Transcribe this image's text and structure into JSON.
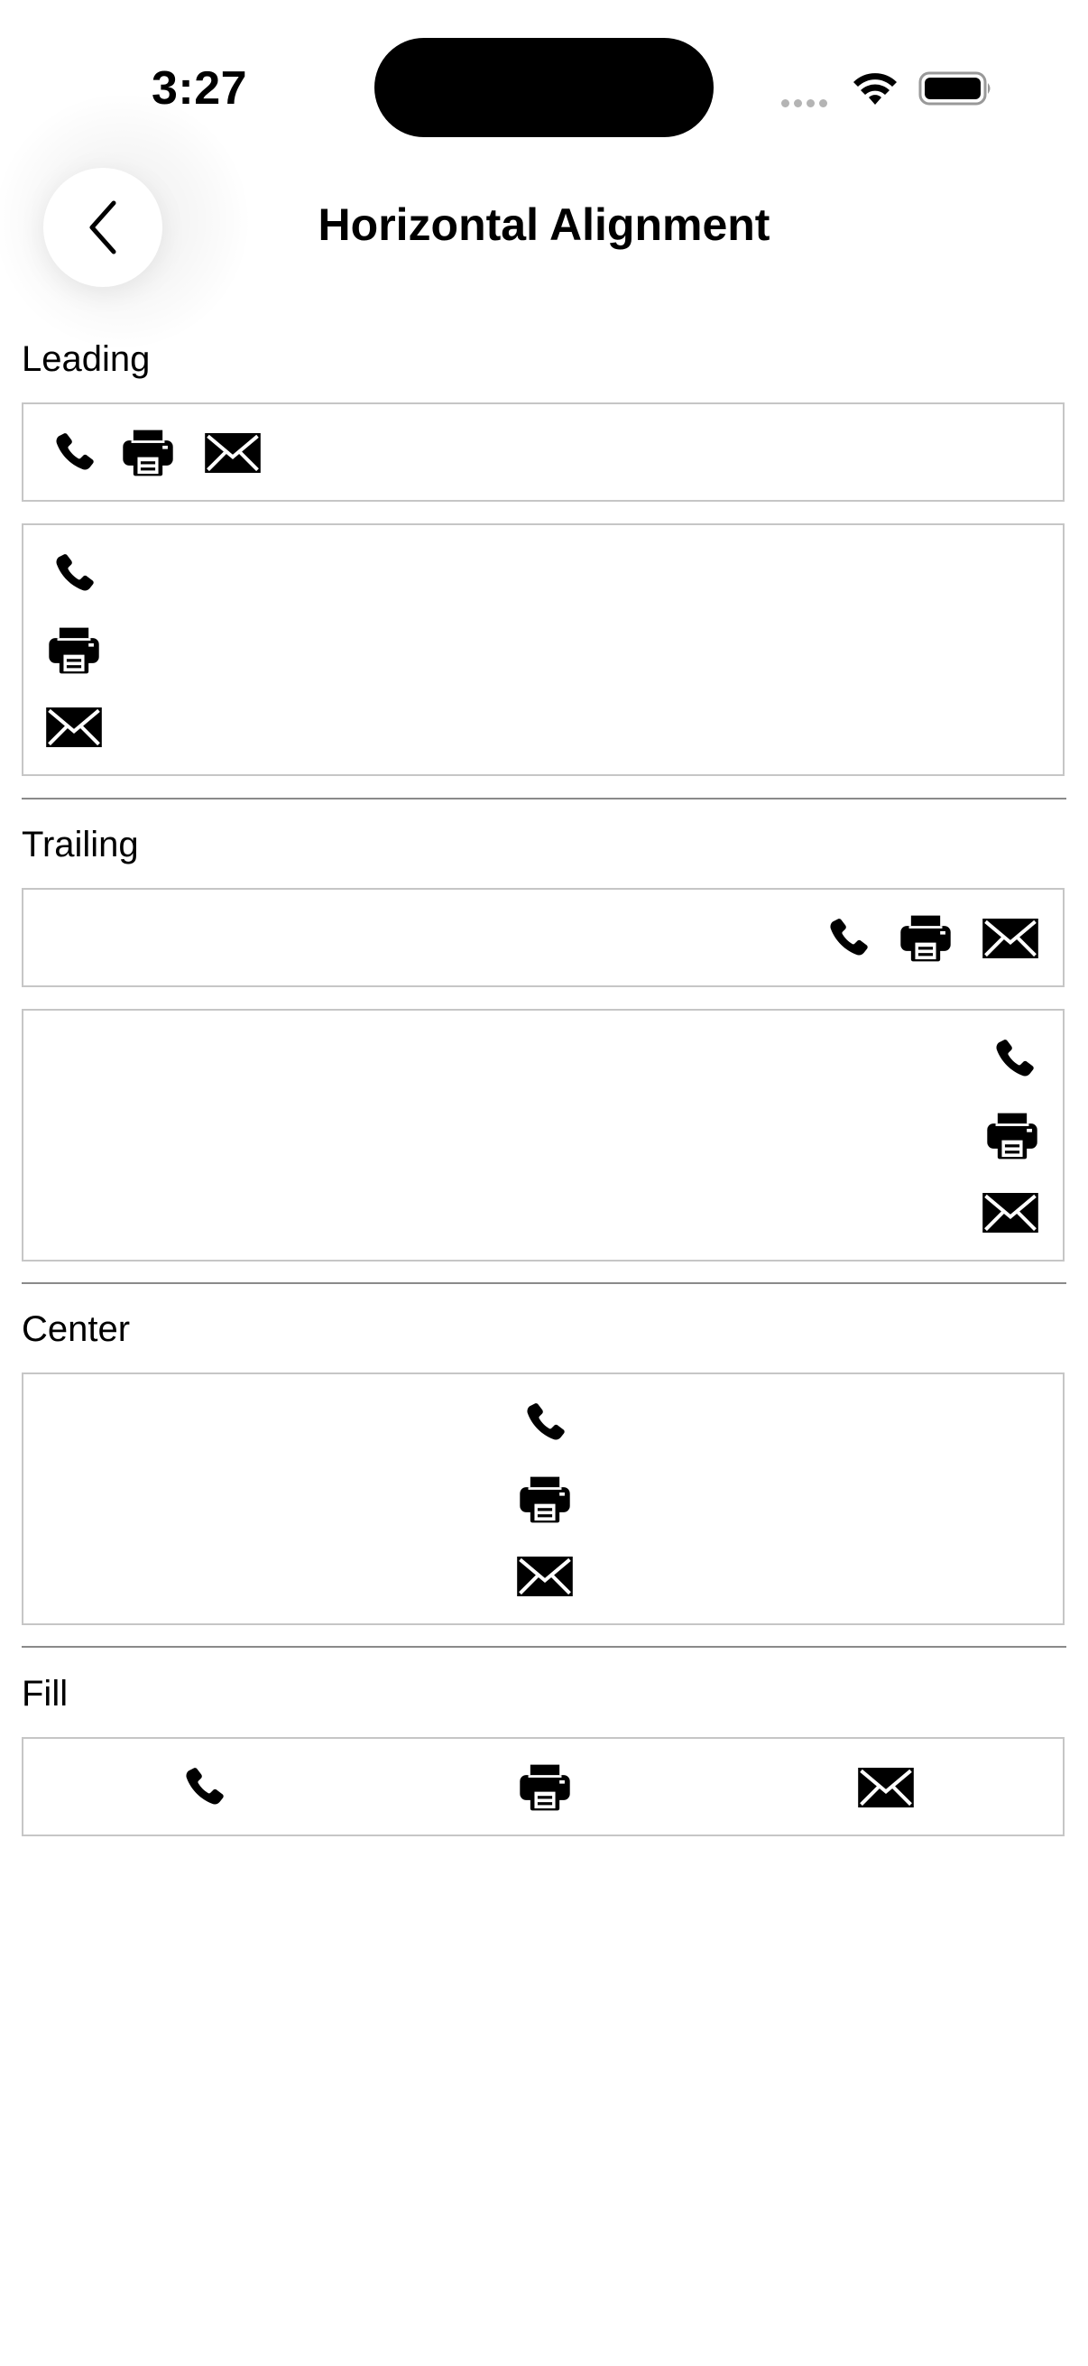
{
  "status_bar": {
    "time": "3:27"
  },
  "nav": {
    "title": "Horizontal Alignment"
  },
  "sections": {
    "leading": {
      "label": "Leading"
    },
    "trailing": {
      "label": "Trailing"
    },
    "center": {
      "label": "Center"
    },
    "fill": {
      "label": "Fill"
    }
  },
  "icons": [
    "phone-icon",
    "printer-icon",
    "envelope-icon"
  ]
}
